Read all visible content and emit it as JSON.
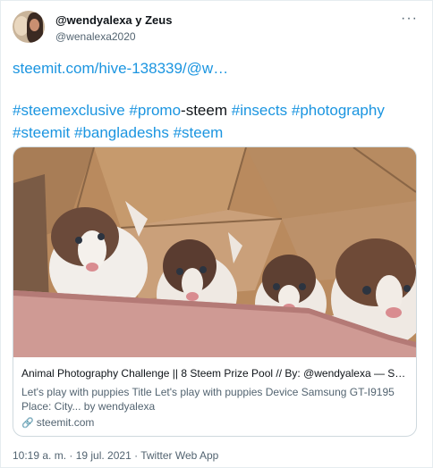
{
  "tweet": {
    "display_name": "@wendyalexa y Zeus",
    "handle": "@wenalexa2020",
    "more_label": "···",
    "link_text": "steemit.com/hive-138339/@w…",
    "hashtags": {
      "steemexclusive": "#steemexclusive",
      "promo": "#promo",
      "plain": "-steem",
      "insects": "#insects",
      "photography": "#photography",
      "steemit": "#steemit",
      "bangladeshs": "#bangladeshs",
      "steem": "#steem"
    },
    "timestamp": "10:19 a. m. · 19 jul. 2021 · Twitter Web App"
  },
  "card": {
    "title": "Animal Photography Challenge || 8 Steem Prize Pool // By: @wendyalexa — Stee…",
    "description": "Let's play with puppies Title Let's play with puppies Device Samsung GT-I9195 Place: City... by wendyalexa",
    "domain": "steemit.com",
    "link_icon": "link-icon"
  },
  "colors": {
    "link": "#1b95e0",
    "text": "#0f1419",
    "muted": "#536471",
    "border": "#cfd9de"
  }
}
